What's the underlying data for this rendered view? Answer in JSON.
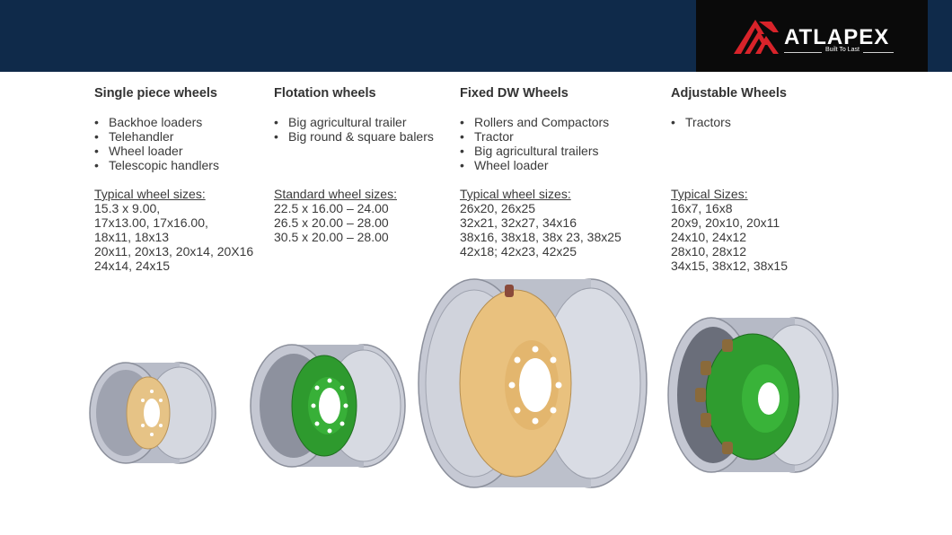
{
  "brand": {
    "name": "ATLAPEX",
    "tagline": "Built To Last",
    "colors": {
      "header": "#0f2a4a",
      "logo_bg": "#0a0a0a",
      "logo_red": "#d8232a"
    }
  },
  "columns": [
    {
      "title": "Single piece wheels",
      "applications": [
        "Backhoe loaders",
        "Telehandler",
        "Wheel loader",
        "Telescopic handlers"
      ],
      "sizes_title": "Typical wheel sizes:",
      "sizes": [
        "15.3 x 9.00,",
        "17x13.00, 17x16.00,",
        "18x11, 18x13",
        "20x11, 20x13, 20x14, 20X16",
        "24x14, 24x15"
      ],
      "center_color": "#e6c386"
    },
    {
      "title": "Flotation wheels",
      "applications": [
        "Big agricultural trailer",
        "Big round & square balers"
      ],
      "sizes_title": "Standard wheel sizes:",
      "sizes": [
        "22.5 x 16.00 – 24.00",
        "26.5 x 20.00 – 28.00",
        "30.5 x 20.00 – 28.00"
      ],
      "center_color": "#2e9a2e"
    },
    {
      "title": "Fixed DW Wheels",
      "applications": [
        "Rollers and Compactors",
        "Tractor",
        "Big agricultural trailers",
        "Wheel loader"
      ],
      "sizes_title": "Typical wheel sizes:",
      "sizes": [
        "26x20, 26x25",
        "32x21, 32x27, 34x16",
        "38x16, 38x18, 38x 23, 38x25",
        "42x18; 42x23, 42x25"
      ],
      "center_color": "#e9c17e"
    },
    {
      "title": "Adjustable Wheels",
      "applications": [
        "Tractors"
      ],
      "sizes_title": "Typical Sizes:",
      "sizes": [
        "16x7, 16x8",
        "20x9, 20x10, 20x11",
        "24x10, 24x12",
        "28x10, 28x12",
        "34x15, 38x12, 38x15"
      ],
      "center_color": "#2f9c2f"
    }
  ]
}
